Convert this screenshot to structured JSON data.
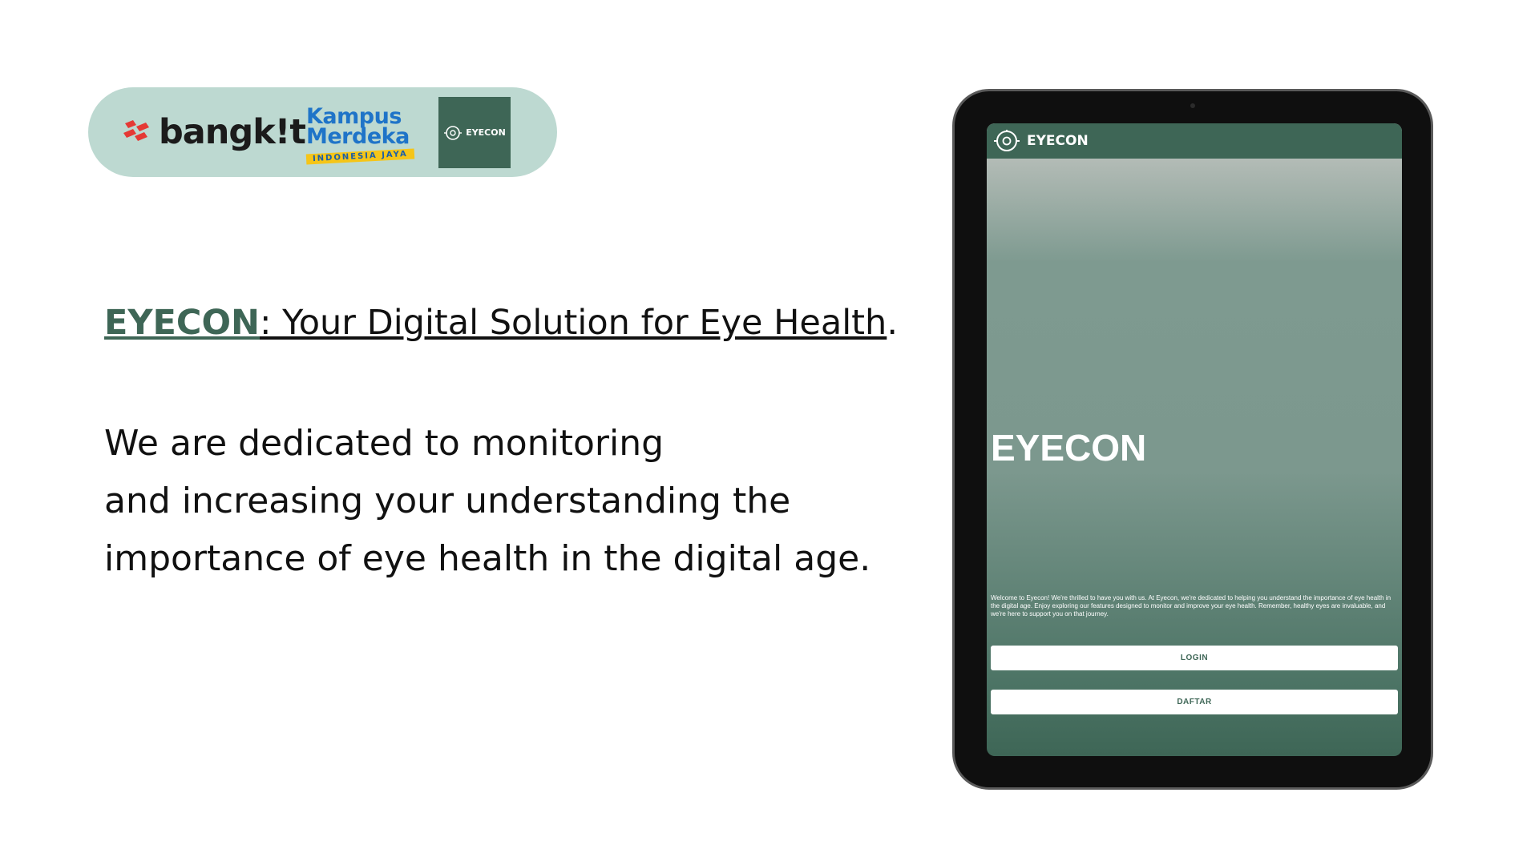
{
  "partners": {
    "bangkit_text": "bangk!t",
    "kampus_line1": "Kampus",
    "kampus_line2": "Merdeka",
    "kampus_sub": "INDONESIA JAYA",
    "eyecon_tile_label": "EYECON"
  },
  "headline": {
    "brand": "EYECON",
    "tagline": ": Your Digital Solution for Eye Health",
    "end": "."
  },
  "description": {
    "lines": [
      "We are dedicated to monitoring",
      "and increasing your understanding the",
      "importance of eye health in the digital age."
    ]
  },
  "tablet": {
    "app_bar_title": "EYECON",
    "hero_title": "EYECON",
    "welcome_text": "Welcome to Eyecon! We're thrilled to have you with us. At Eyecon, we're dedicated to helping you understand the importance of eye health in the digital age. Enjoy exploring our features designed to monitor and improve your eye health. Remember, healthy eyes are invaluable, and we're here to support you on that journey.",
    "login_label": "LOGIN",
    "daftar_label": "DAFTAR"
  },
  "colors": {
    "brand_green": "#3e6656",
    "pill_background": "#bdd9d1",
    "bangkit_red": "#e53935",
    "kampus_blue": "#1f74c8"
  },
  "icons": [
    "bangkit-logo-icon",
    "eye-logo-icon"
  ]
}
